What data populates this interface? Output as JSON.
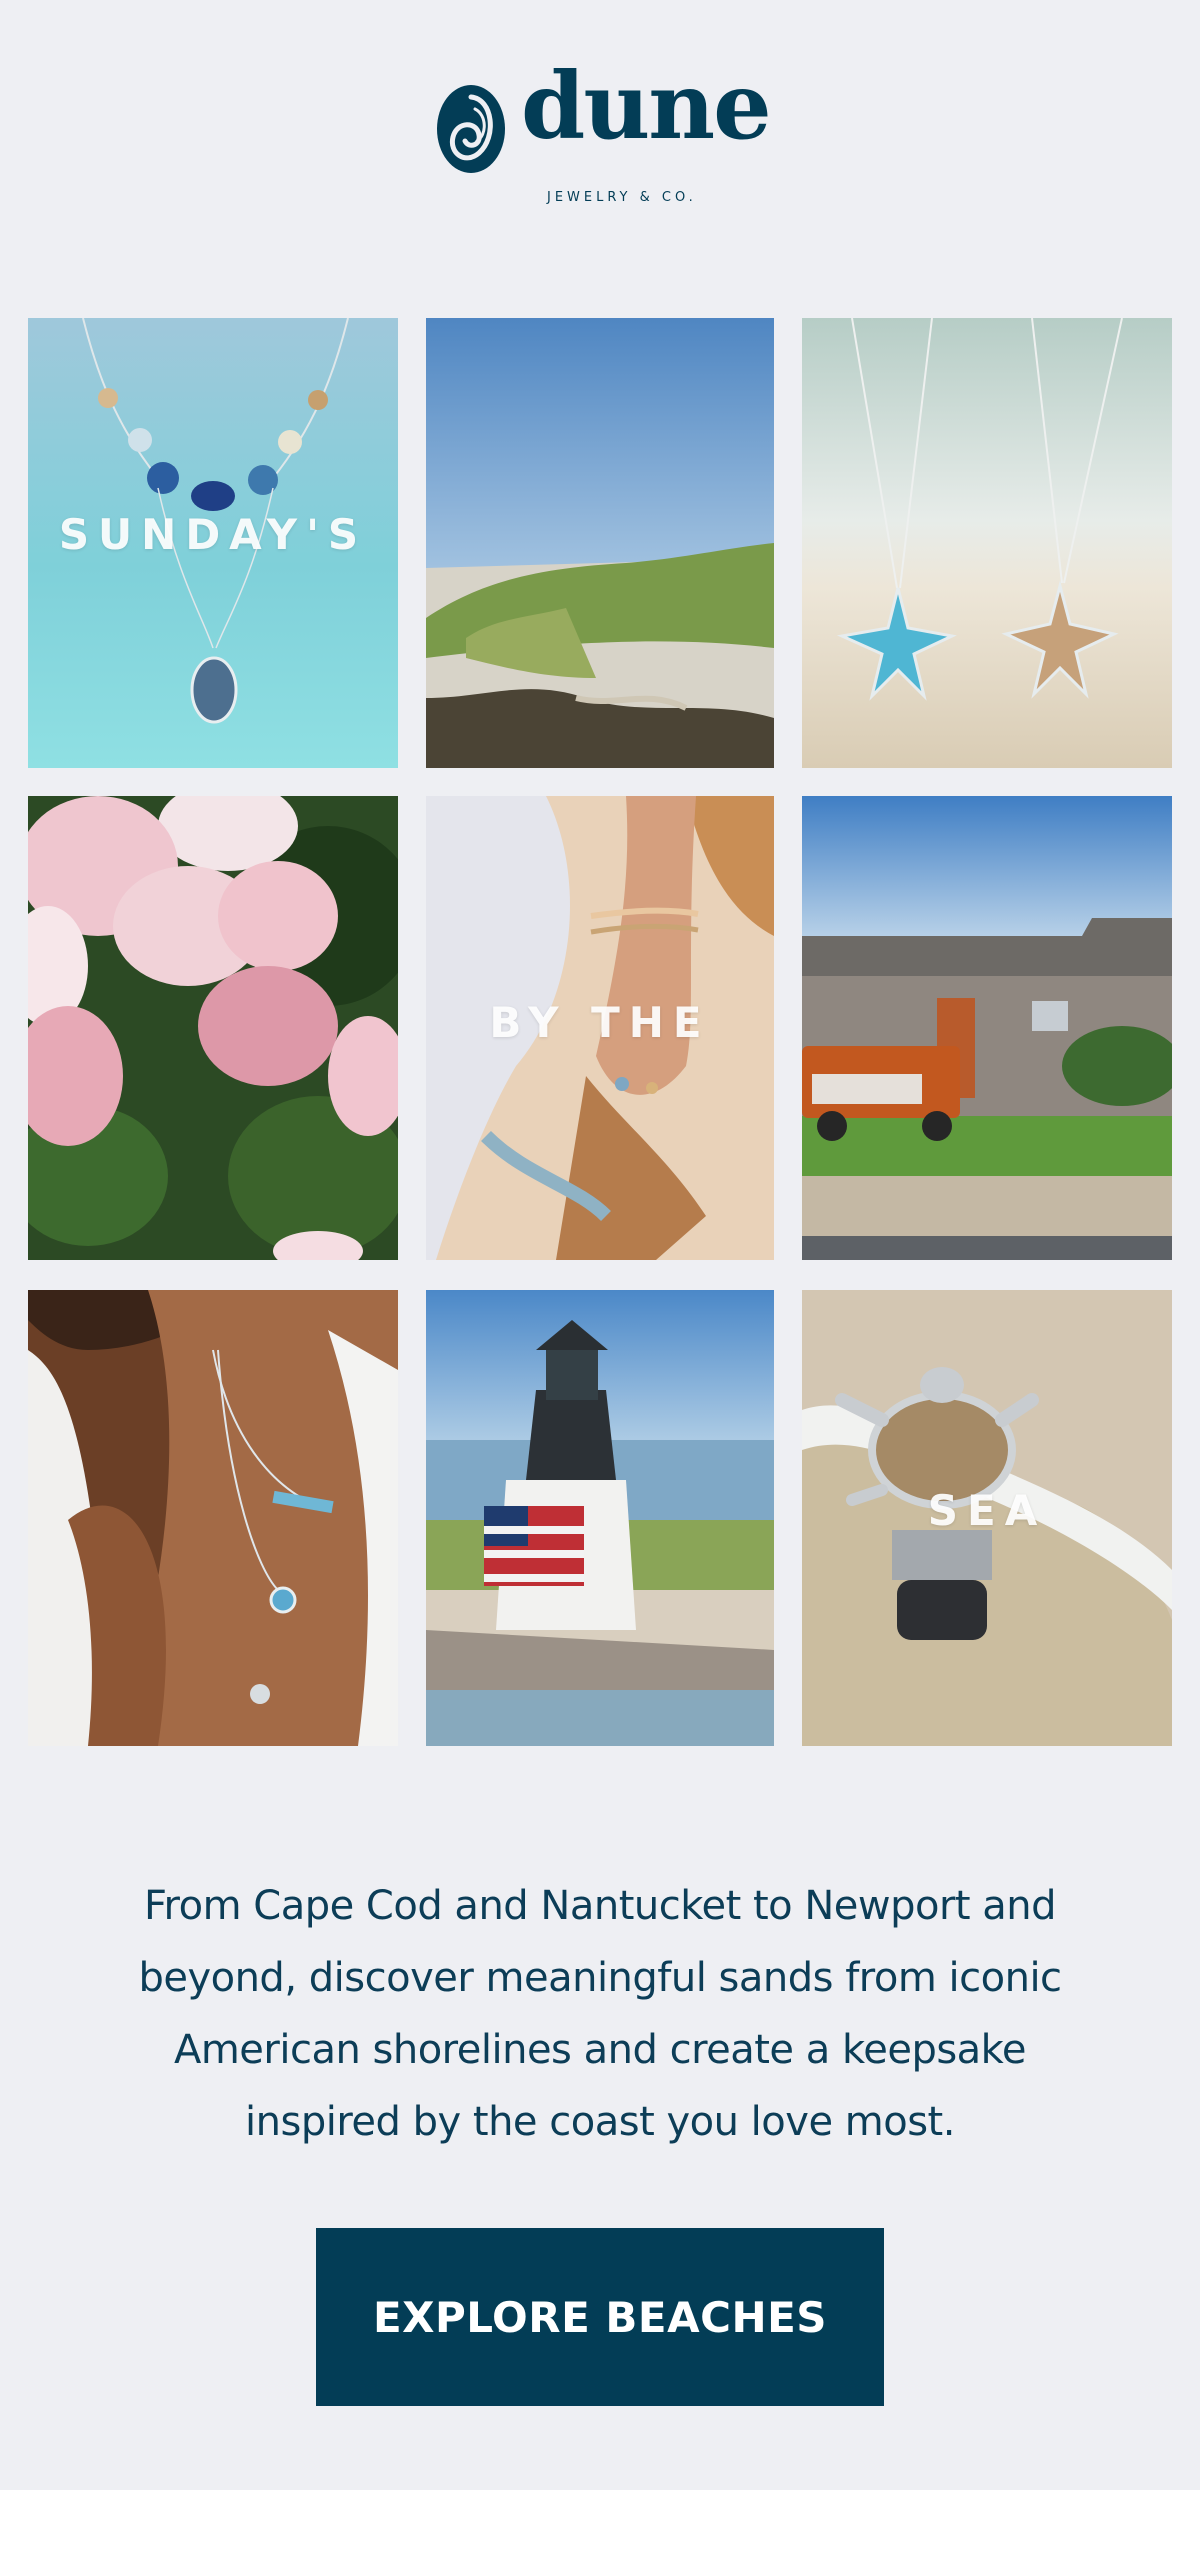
{
  "brand": {
    "name": "dune",
    "tagline": "JEWELRY & CO.",
    "color": "#033d56"
  },
  "gallery": {
    "tiles": [
      {
        "name": "necklace-gemstone",
        "overlay": "SUNDAY'S"
      },
      {
        "name": "dune-grass",
        "overlay": ""
      },
      {
        "name": "starfish-necklaces",
        "overlay": ""
      },
      {
        "name": "hydrangea",
        "overlay": ""
      },
      {
        "name": "hand-bracelets",
        "overlay": "BY THE"
      },
      {
        "name": "cottage-truck",
        "overlay": ""
      },
      {
        "name": "layered-necklaces",
        "overlay": ""
      },
      {
        "name": "lighthouse",
        "overlay": ""
      },
      {
        "name": "turtle-bottle-stopper",
        "overlay": "SEA"
      }
    ]
  },
  "body_copy": {
    "line1": "From Cape Cod and Nantucket to Newport and",
    "line2": "beyond, discover meaningful sands from iconic",
    "line3": "American shorelines and create a keepsake",
    "line4": "inspired by the coast you love most."
  },
  "cta": {
    "label": "EXPLORE BEACHES"
  }
}
